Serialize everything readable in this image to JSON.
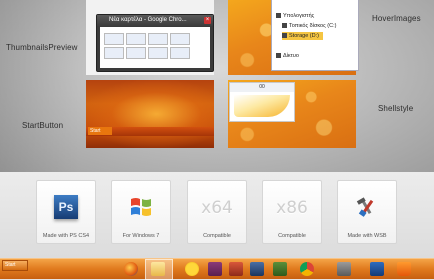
{
  "labels": {
    "thumbnails_preview": "ThumbnailsPreview",
    "hover_images": "HoverImages",
    "start_button": "StartButton",
    "shellstyle": "Shellstyle"
  },
  "preview_window": {
    "title": "Νέα καρτέλα - Google Chro..."
  },
  "explorer": {
    "items": [
      "Υπολογιστής",
      "Τοπικός δίσκος (C:)",
      "Storage (D:)",
      "Δίκτυο"
    ],
    "selected": "Storage (D:)"
  },
  "start_preview": {
    "button_label": "Start"
  },
  "shell_menu": {
    "top_text": "00"
  },
  "badges": [
    {
      "caption": "Made with PS CS4",
      "icon": "photoshop-icon",
      "text": "Ps"
    },
    {
      "caption": "For Windows 7",
      "icon": "windows-logo-icon",
      "text": ""
    },
    {
      "caption": "Compatible",
      "icon": "x64-icon",
      "text": "x64"
    },
    {
      "caption": "Compatible",
      "icon": "x86-icon",
      "text": "x86"
    },
    {
      "caption": "Made with WSB",
      "icon": "wsb-tools-icon",
      "text": ""
    }
  ],
  "taskbar": {
    "start_label": "Start",
    "icons": [
      "firefox-icon",
      "explorer-folder-icon",
      "duck-icon",
      "media-player-icon",
      "app-icon",
      "network-icon",
      "settings-icon",
      "chrome-icon",
      "tools-icon",
      "book-icon",
      "vlc-icon"
    ]
  },
  "colors": {
    "accent": "#e8861a",
    "taskbar": "#e07a1e"
  }
}
